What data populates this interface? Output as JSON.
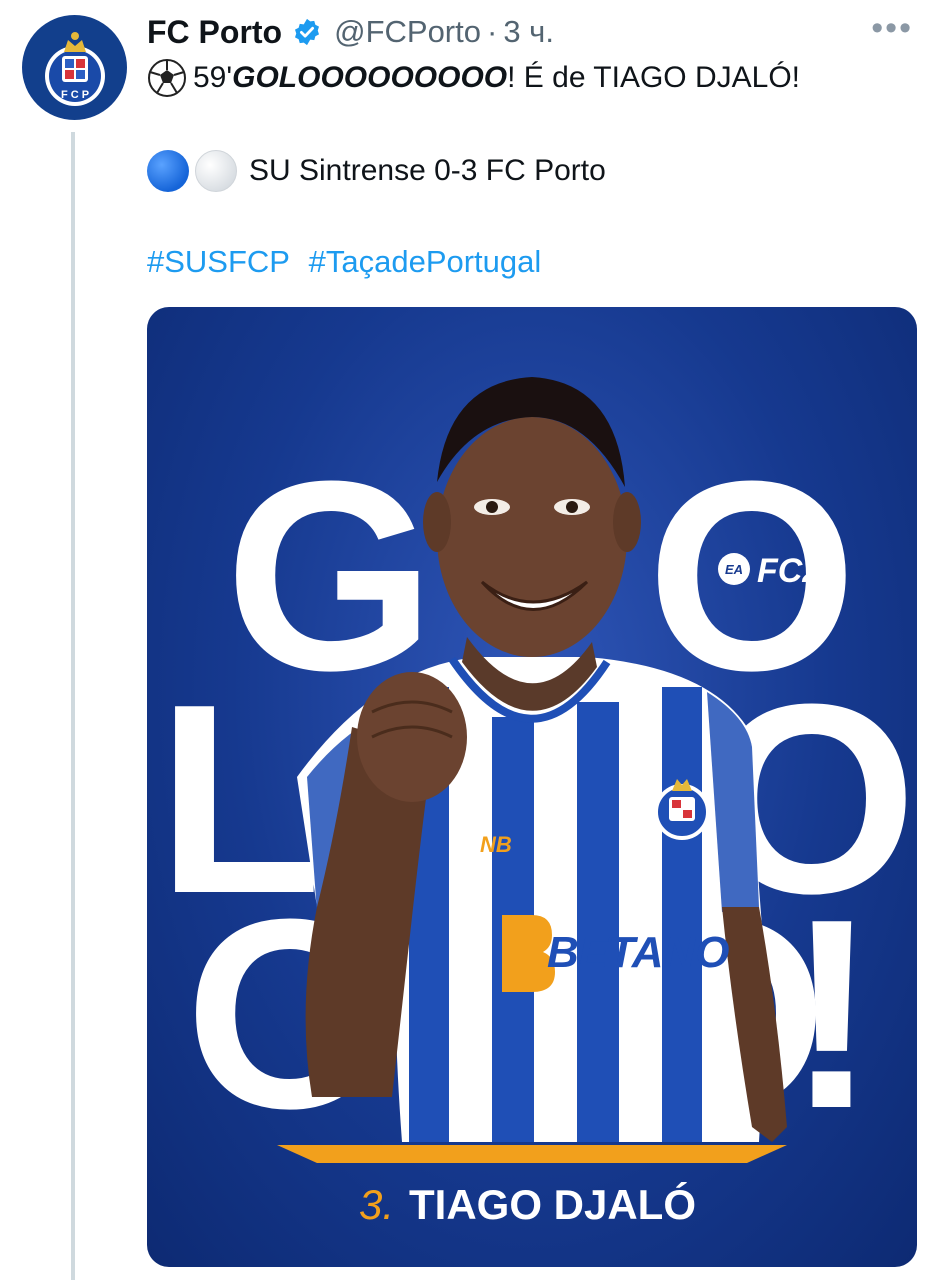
{
  "tweet": {
    "author_name": "FC Porto",
    "handle": "@FCPorto",
    "separator": "·",
    "time": "3 ч.",
    "text_prefix": "59' ",
    "goal_word": "GOLOOOOOOOOO",
    "text_suffix": "! É de TIAGO DJALÓ!",
    "score_line": "SU Sintrense 0-3 FC Porto",
    "hashtags": [
      "#SUSFCP",
      "#TaçadePortugal"
    ]
  },
  "card": {
    "big_letters": [
      "G",
      "O",
      "L",
      "O",
      "O",
      "O",
      "!"
    ],
    "brand": "FC25",
    "ea_text": "EA",
    "sponsor": "BETANO",
    "player_number": "3.",
    "player_name": "TIAGO DJALÓ"
  },
  "colors": {
    "brand_blue": "#16398f",
    "link_blue": "#1d9bf0",
    "accent_orange": "#f2a01c",
    "muted_text": "#536471"
  },
  "icons": {
    "verified": "verified-badge-icon",
    "more": "more-options-icon",
    "ball": "soccer-ball-icon",
    "crest": "fcp-crest-icon"
  }
}
